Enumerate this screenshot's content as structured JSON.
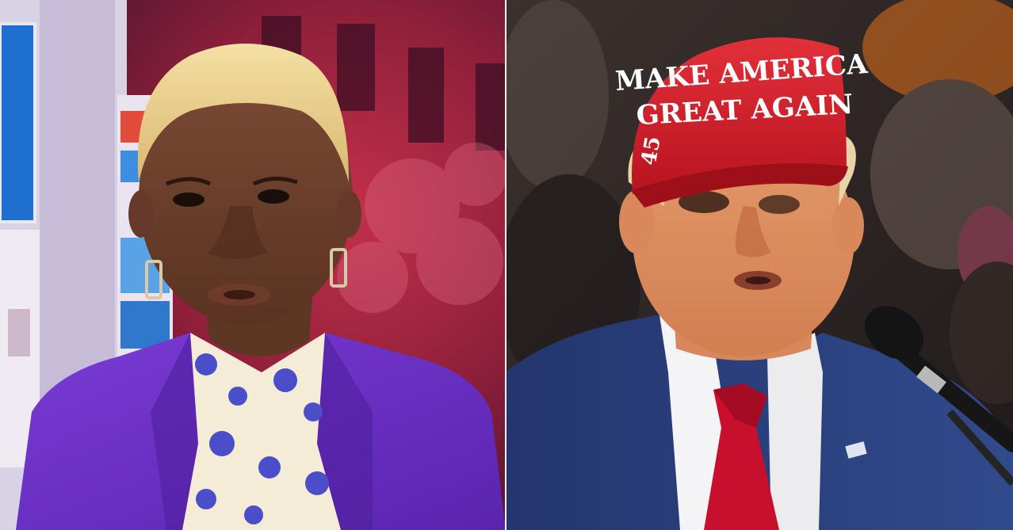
{
  "image": {
    "layout": "split-screen two-panel still",
    "left_panel": {
      "subject": "news-anchor",
      "background": "studio-monitors-and-red-tinted-city-screen",
      "outfit_color": "#6a2fc4"
    },
    "right_panel": {
      "subject": "rally-speaker",
      "hat_text_line1": "MAKE AMERICA",
      "hat_text_line2": "GREAT AGAIN",
      "hat_color": "#d4202a",
      "tie_color": "#c8102e",
      "suit_color": "#2b3f7a",
      "has_microphone": true
    }
  }
}
